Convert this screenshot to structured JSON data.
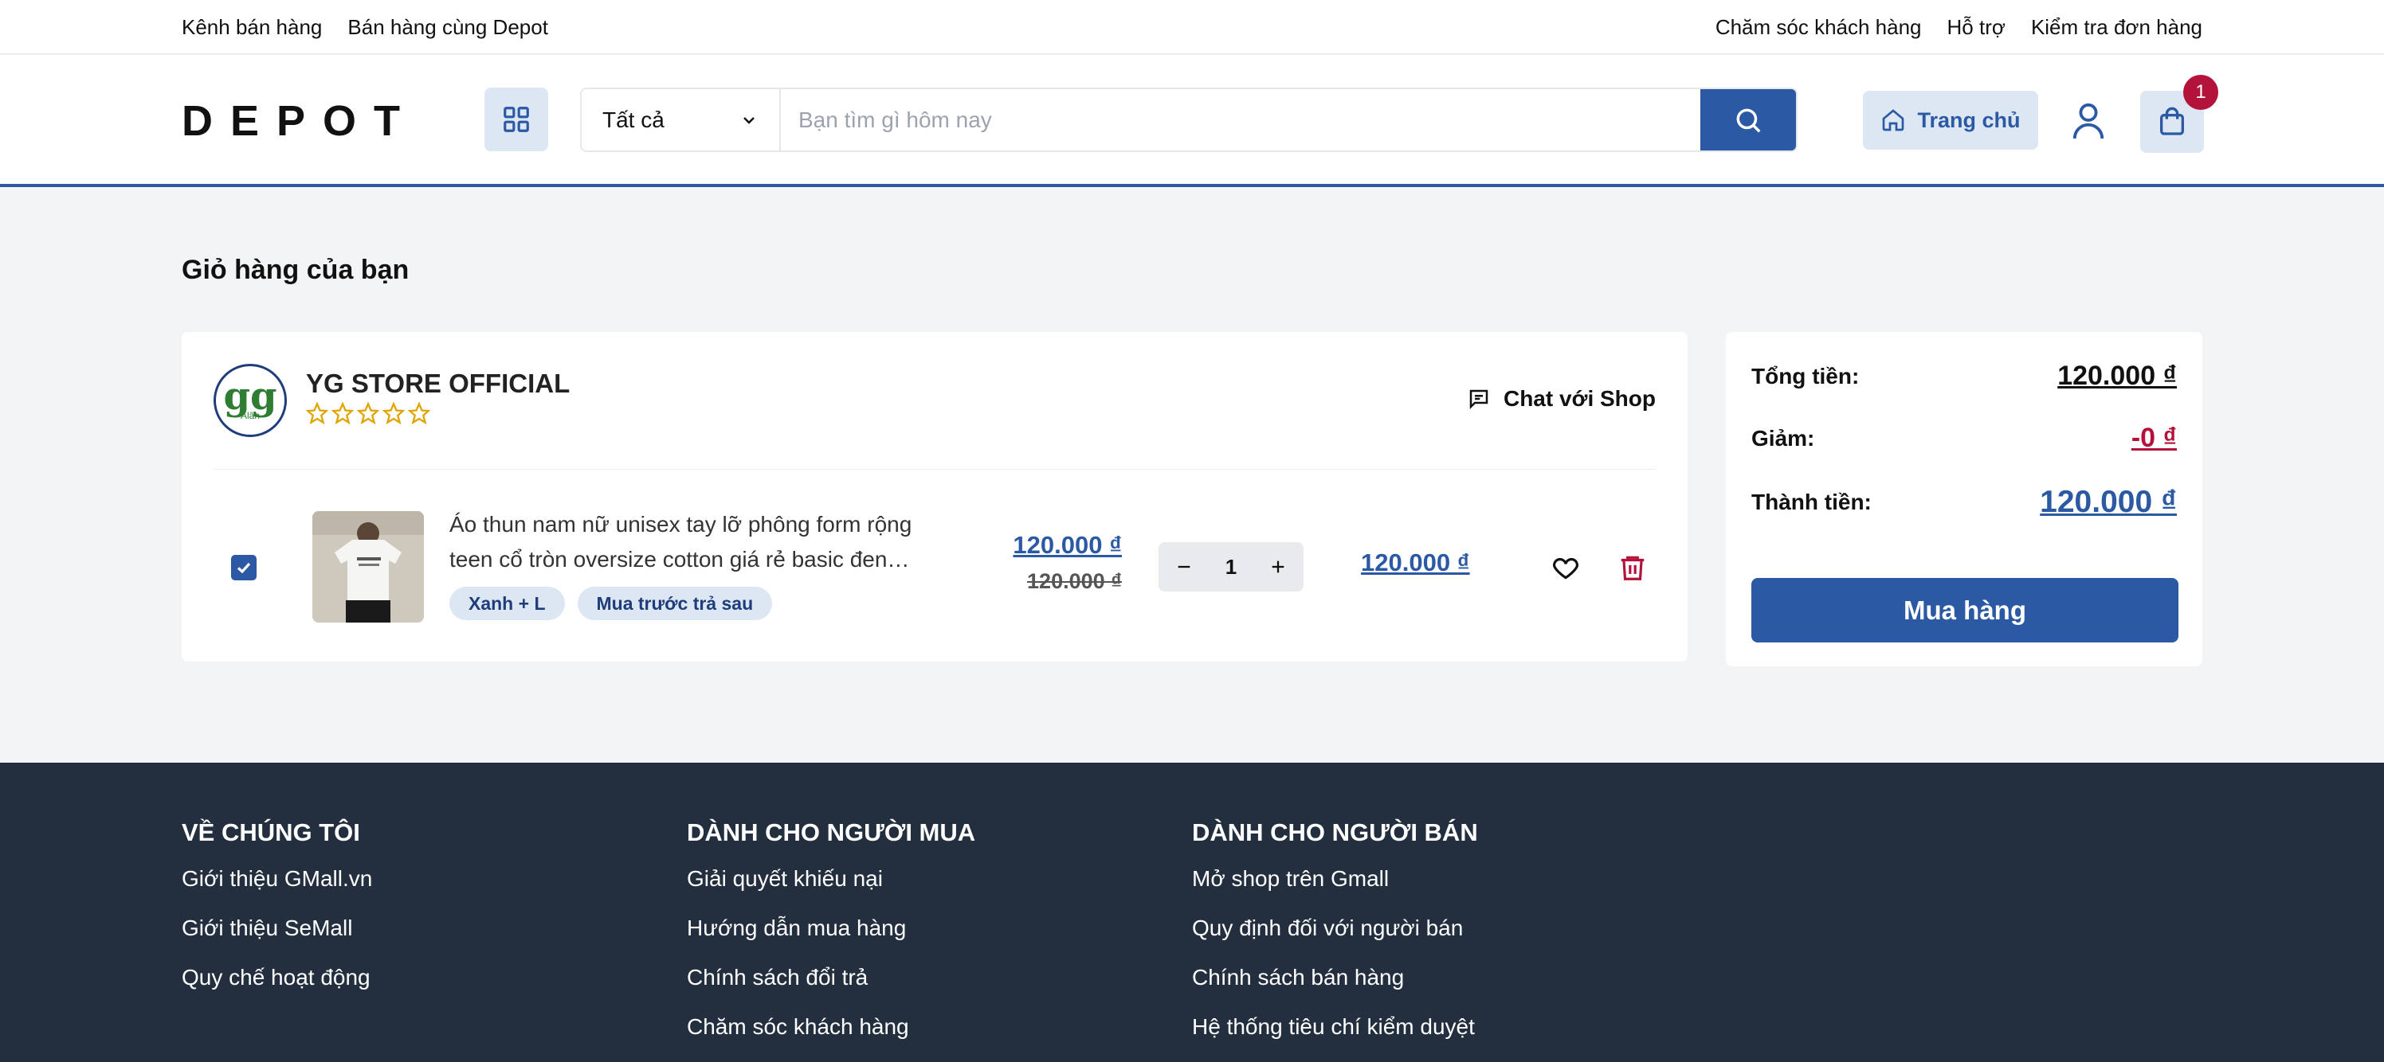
{
  "topbar": {
    "left_links": [
      "Kênh bán hàng",
      "Bán hàng cùng Depot"
    ],
    "right_links": [
      "Chăm sóc khách hàng",
      "Hỗ trợ",
      "Kiểm tra đơn hàng"
    ]
  },
  "header": {
    "logo": "DEPOT",
    "category_select": "Tất cả",
    "search_placeholder": "Bạn tìm gì hôm nay",
    "home_label": "Trang chủ",
    "cart_count": "1"
  },
  "page_title": "Giỏ hàng của bạn",
  "shop": {
    "name": "YG STORE OFFICIAL",
    "logo_text": "gg",
    "logo_subtext": "Alân",
    "rating_stars": 0,
    "chat_label": "Chat với Shop"
  },
  "cart_item": {
    "checked": true,
    "name": "Áo thun nam nữ unisex tay lỡ phông form rộng teen cổ tròn oversize cotton giá rẻ basic đen…",
    "tags": [
      "Xanh + L",
      "Mua trước trả sau"
    ],
    "price": "120.000 ₫",
    "old_price": "120.000 ₫",
    "quantity": "1",
    "line_total": "120.000 ₫"
  },
  "summary": {
    "total_label": "Tổng tiền:",
    "total_value": "120.000 ₫",
    "discount_label": "Giảm:",
    "discount_value": "-0 ₫",
    "final_label": "Thành tiền:",
    "final_value": "120.000 ₫",
    "buy_label": "Mua hàng"
  },
  "footer": {
    "columns": [
      {
        "title": "VỀ CHÚNG TÔI",
        "links": [
          "Giới thiệu GMall.vn",
          "Giới thiệu SeMall",
          "Quy chế hoạt động"
        ]
      },
      {
        "title": "DÀNH CHO NGƯỜI MUA",
        "links": [
          "Giải quyết khiếu nại",
          "Hướng dẫn mua hàng",
          "Chính sách đổi trả",
          "Chăm sóc khách hàng"
        ]
      },
      {
        "title": "DÀNH CHO NGƯỜI BÁN",
        "links": [
          "Mở shop trên Gmall",
          "Quy định đối với người bán",
          "Chính sách bán hàng",
          "Hệ thống tiêu chí kiểm duyệt"
        ]
      }
    ]
  },
  "colors": {
    "primary": "#2b59a3",
    "accent_red": "#b3123b",
    "footer_bg": "#232f3e",
    "page_bg": "#f3f4f6"
  }
}
